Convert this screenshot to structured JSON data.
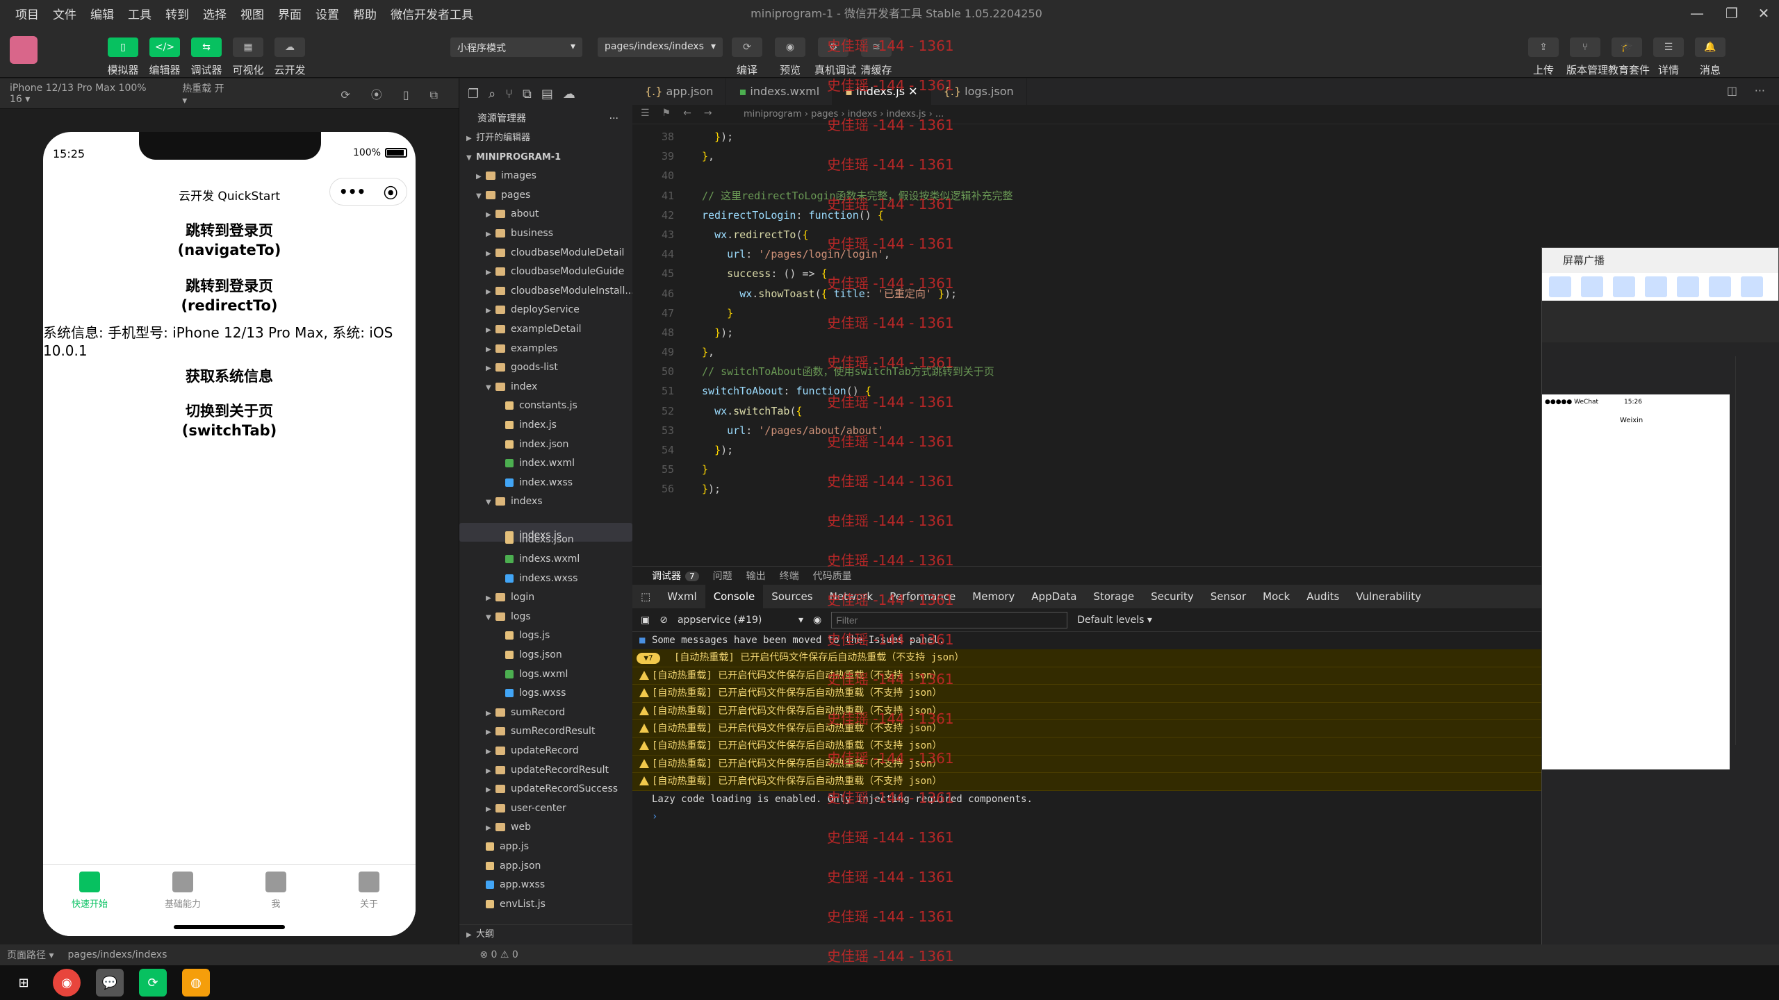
{
  "menu": [
    "项目",
    "文件",
    "编辑",
    "工具",
    "转到",
    "选择",
    "视图",
    "界面",
    "设置",
    "帮助",
    "微信开发者工具"
  ],
  "window_title": "miniprogram-1 - 微信开发者工具 Stable 1.05.2204250",
  "toolbar": {
    "left": [
      {
        "label": "模拟器",
        "glyph": "▯"
      },
      {
        "label": "编辑器",
        "glyph": "</>"
      },
      {
        "label": "调试器",
        "glyph": "⇆"
      },
      {
        "label": "可视化",
        "glyph": "▦"
      },
      {
        "label": "云开发",
        "glyph": "☁"
      }
    ],
    "mode_select": "小程序模式",
    "page_select": "pages/indexs/indexs",
    "mid": [
      {
        "label": "编译",
        "glyph": "⟳"
      },
      {
        "label": "预览",
        "glyph": "◉"
      },
      {
        "label": "真机调试",
        "glyph": "⚙"
      },
      {
        "label": "清缓存",
        "glyph": "≋"
      }
    ],
    "right": [
      {
        "label": "上传",
        "glyph": "⇪"
      },
      {
        "label": "版本管理",
        "glyph": "⑂"
      },
      {
        "label": "教育套件",
        "glyph": "🎓"
      },
      {
        "label": "详情",
        "glyph": "☰"
      },
      {
        "label": "消息",
        "glyph": "🔔"
      }
    ]
  },
  "sim_bar": {
    "device": "iPhone 12/13 Pro Max 100% 16 ▾",
    "hot_reload": "热重载 开 ▾"
  },
  "phone": {
    "time": "15:25",
    "battery": "100%",
    "title": "云开发 QuickStart",
    "capsule_dots": "•••",
    "capsule_close": "⦿",
    "buttons": [
      {
        "line1": "跳转到登录页",
        "line2": "(navigateTo)"
      },
      {
        "line1": "跳转到登录页",
        "line2": "(redirectTo)"
      }
    ],
    "sysinfo": "系统信息: 手机型号: iPhone 12/13 Pro Max, 系统: iOS 10.0.1",
    "btn3": "获取系统信息",
    "btn4_l1": "切换到关于页",
    "btn4_l2": "(switchTab)",
    "tabs": [
      "快速开始",
      "基础能力",
      "我",
      "关于"
    ]
  },
  "explorer": {
    "header": "资源管理器",
    "more": "···",
    "open_editors": "打开的编辑器",
    "project": "MINIPROGRAM-1",
    "outline": "大纲",
    "tree": [
      {
        "d": 1,
        "t": "images",
        "k": "folder",
        "o": false
      },
      {
        "d": 1,
        "t": "pages",
        "k": "folder",
        "o": true
      },
      {
        "d": 2,
        "t": "about",
        "k": "folder",
        "o": false
      },
      {
        "d": 2,
        "t": "business",
        "k": "folder",
        "o": false
      },
      {
        "d": 2,
        "t": "cloudbaseModuleDetail",
        "k": "folder",
        "o": false
      },
      {
        "d": 2,
        "t": "cloudbaseModuleGuide",
        "k": "folder",
        "o": false
      },
      {
        "d": 2,
        "t": "cloudbaseModuleInstall...",
        "k": "folder",
        "o": false
      },
      {
        "d": 2,
        "t": "deployService",
        "k": "folder",
        "o": false
      },
      {
        "d": 2,
        "t": "exampleDetail",
        "k": "folder",
        "o": false
      },
      {
        "d": 2,
        "t": "examples",
        "k": "folder",
        "o": false
      },
      {
        "d": 2,
        "t": "goods-list",
        "k": "folder",
        "o": false
      },
      {
        "d": 2,
        "t": "index",
        "k": "folder",
        "o": true
      },
      {
        "d": 3,
        "t": "constants.js",
        "k": "js"
      },
      {
        "d": 3,
        "t": "index.js",
        "k": "js"
      },
      {
        "d": 3,
        "t": "index.json",
        "k": "json"
      },
      {
        "d": 3,
        "t": "index.wxml",
        "k": "wxml"
      },
      {
        "d": 3,
        "t": "index.wxss",
        "k": "wxss"
      },
      {
        "d": 2,
        "t": "indexs",
        "k": "folder",
        "o": true
      },
      {
        "d": 3,
        "t": "indexs.js",
        "k": "js",
        "sel": true
      },
      {
        "d": 3,
        "t": "indexs.json",
        "k": "json"
      },
      {
        "d": 3,
        "t": "indexs.wxml",
        "k": "wxml"
      },
      {
        "d": 3,
        "t": "indexs.wxss",
        "k": "wxss"
      },
      {
        "d": 2,
        "t": "login",
        "k": "folder",
        "o": false
      },
      {
        "d": 2,
        "t": "logs",
        "k": "folder",
        "o": true
      },
      {
        "d": 3,
        "t": "logs.js",
        "k": "js"
      },
      {
        "d": 3,
        "t": "logs.json",
        "k": "json"
      },
      {
        "d": 3,
        "t": "logs.wxml",
        "k": "wxml"
      },
      {
        "d": 3,
        "t": "logs.wxss",
        "k": "wxss"
      },
      {
        "d": 2,
        "t": "sumRecord",
        "k": "folder",
        "o": false
      },
      {
        "d": 2,
        "t": "sumRecordResult",
        "k": "folder",
        "o": false
      },
      {
        "d": 2,
        "t": "updateRecord",
        "k": "folder",
        "o": false
      },
      {
        "d": 2,
        "t": "updateRecordResult",
        "k": "folder",
        "o": false
      },
      {
        "d": 2,
        "t": "updateRecordSuccess",
        "k": "folder",
        "o": false
      },
      {
        "d": 2,
        "t": "user-center",
        "k": "folder",
        "o": false
      },
      {
        "d": 2,
        "t": "web",
        "k": "folder",
        "o": false
      },
      {
        "d": 1,
        "t": "app.js",
        "k": "js"
      },
      {
        "d": 1,
        "t": "app.json",
        "k": "json"
      },
      {
        "d": 1,
        "t": "app.wxss",
        "k": "wxss"
      },
      {
        "d": 1,
        "t": "envList.js",
        "k": "js"
      }
    ]
  },
  "editor": {
    "tabs": [
      {
        "t": "app.json",
        "k": "json"
      },
      {
        "t": "indexs.wxml",
        "k": "wxml"
      },
      {
        "t": "indexs.js",
        "k": "js",
        "act": true
      },
      {
        "t": "logs.json",
        "k": "json"
      }
    ],
    "breadcrumb": "miniprogram › pages › indexs › indexs.js › ...",
    "lines": [
      {
        "n": "38",
        "h": "  <span class='y'>}</span>);"
      },
      {
        "n": "39",
        "h": "<span class='y'>}</span>,"
      },
      {
        "n": "40",
        "h": ""
      },
      {
        "n": "41",
        "h": "<span class='c'>// 这里redirectToLogin函数未完整，假设按类似逻辑补充完整</span>"
      },
      {
        "n": "42",
        "h": "<span class='p'>redirectToLogin</span>: <span class='p'>function</span>() <span class='y'>{</span>"
      },
      {
        "n": "43",
        "h": "  <span class='p'>wx</span>.<span class='k'>redirectTo</span>(<span class='y'>{</span>"
      },
      {
        "n": "44",
        "h": "    <span class='p'>url</span>: <span class='s'>'/pages/login/login'</span>,"
      },
      {
        "n": "45",
        "h": "    <span class='k'>success</span>: () => <span class='y'>{</span>"
      },
      {
        "n": "46",
        "h": "      <span class='p'>wx</span>.<span class='k'>showToast</span>(<span class='y'>{</span> <span class='p'>title</span>: <span class='s'>'已重定向'</span> <span class='y'>}</span>);"
      },
      {
        "n": "47",
        "h": "    <span class='y'>}</span>"
      },
      {
        "n": "48",
        "h": "  <span class='y'>}</span>);"
      },
      {
        "n": "49",
        "h": "<span class='y'>}</span>,"
      },
      {
        "n": "50",
        "h": "<span class='c'>// switchToAbout函数，使用switchTab方式跳转到关于页</span>"
      },
      {
        "n": "51",
        "h": "<span class='p'>switchToAbout</span>: <span class='p'>function</span>() <span class='y'>{</span>"
      },
      {
        "n": "52",
        "h": "  <span class='p'>wx</span>.<span class='k'>switchTab</span>(<span class='y'>{</span>"
      },
      {
        "n": "53",
        "h": "    <span class='p'>url</span>: <span class='s'>'/pages/about/about'</span>"
      },
      {
        "n": "54",
        "h": "  <span class='y'>}</span>);"
      },
      {
        "n": "55",
        "h": "<span class='y'>}</span>"
      },
      {
        "n": "56",
        "h": "<span class='y'>}</span>);"
      }
    ]
  },
  "debug": {
    "tabs1": [
      {
        "t": "调试器",
        "badge": "7"
      },
      {
        "t": "问题"
      },
      {
        "t": "输出"
      },
      {
        "t": "终端"
      },
      {
        "t": "代码质量"
      }
    ],
    "tabs2": [
      "Wxml",
      "Console",
      "Sources",
      "Network",
      "Performance",
      "Memory",
      "AppData",
      "Storage",
      "Security",
      "Sensor",
      "Mock",
      "Audits",
      "Vulnerability"
    ],
    "context": "appservice (#19)",
    "filter_placeholder": "Filter",
    "levels": "Default levels ▾",
    "issues_msg": "Some messages have been moved to the Issues panel.",
    "group_msg": "[自动热重载] 已开启代码文件保存后自动热重载（不支持 json）",
    "group_count": "7",
    "warn_msgs": [
      "[自动热重载] 已开启代码文件保存后自动热重载（不支持 json）",
      "[自动热重载] 已开启代码文件保存后自动热重载（不支持 json）",
      "[自动热重载] 已开启代码文件保存后自动热重载（不支持 json）",
      "[自动热重载] 已开启代码文件保存后自动热重载（不支持 json）",
      "[自动热重载] 已开启代码文件保存后自动热重载（不支持 json）",
      "[自动热重载] 已开启代码文件保存后自动热重载（不支持 json）",
      "[自动热重载] 已开启代码文件保存后自动热重载（不支持 json）"
    ],
    "lazy_msg": "Lazy code loading is enabled. Only injecting required components."
  },
  "cast": {
    "title": "屏幕广播",
    "mini_time": "15:26",
    "mini_title": "Weixin",
    "mini_carrier": "●●●●● WeChat"
  },
  "statusbar": {
    "path_label": "页面路径 ▾",
    "path": "pages/indexs/indexs",
    "errors": "⊗ 0 ⚠ 0"
  },
  "watermark": "史佳瑶 -144 - 1361",
  "watermark_count": 24
}
